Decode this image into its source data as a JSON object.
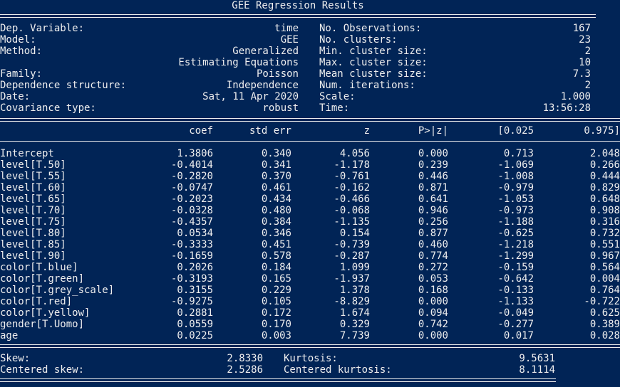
{
  "title": "GEE Regression Results",
  "info_rows": [
    [
      "Dep. Variable:",
      "time",
      "No. Observations:",
      "167"
    ],
    [
      "Model:",
      "GEE",
      "No. clusters:",
      "23"
    ],
    [
      "Method:",
      "Generalized",
      "Min. cluster size:",
      "2"
    ],
    [
      "",
      "Estimating Equations",
      "Max. cluster size:",
      "10"
    ],
    [
      "Family:",
      "Poisson",
      "Mean cluster size:",
      "7.3"
    ],
    [
      "Dependence structure:",
      "Independence",
      "Num. iterations:",
      "2"
    ],
    [
      "Date:",
      "Sat, 11 Apr 2020",
      "Scale:",
      "1.000"
    ],
    [
      "Covariance type:",
      "robust",
      "Time:",
      "13:56:28"
    ]
  ],
  "coef_headers": [
    "coef",
    "std err",
    "z",
    "P>|z|",
    "[0.025",
    "0.975]"
  ],
  "coef_rows": [
    [
      "Intercept",
      "1.3806",
      "0.340",
      "4.056",
      "0.000",
      "0.713",
      "2.048"
    ],
    [
      "level[T.50]",
      "-0.4014",
      "0.341",
      "-1.178",
      "0.239",
      "-1.069",
      "0.266"
    ],
    [
      "level[T.55]",
      "-0.2820",
      "0.370",
      "-0.761",
      "0.446",
      "-1.008",
      "0.444"
    ],
    [
      "level[T.60]",
      "-0.0747",
      "0.461",
      "-0.162",
      "0.871",
      "-0.979",
      "0.829"
    ],
    [
      "level[T.65]",
      "-0.2023",
      "0.434",
      "-0.466",
      "0.641",
      "-1.053",
      "0.648"
    ],
    [
      "level[T.70]",
      "-0.0328",
      "0.480",
      "-0.068",
      "0.946",
      "-0.973",
      "0.908"
    ],
    [
      "level[T.75]",
      "-0.4357",
      "0.384",
      "-1.135",
      "0.256",
      "-1.188",
      "0.316"
    ],
    [
      "level[T.80]",
      "0.0534",
      "0.346",
      "0.154",
      "0.877",
      "-0.625",
      "0.732"
    ],
    [
      "level[T.85]",
      "-0.3333",
      "0.451",
      "-0.739",
      "0.460",
      "-1.218",
      "0.551"
    ],
    [
      "level[T.90]",
      "-0.1659",
      "0.578",
      "-0.287",
      "0.774",
      "-1.299",
      "0.967"
    ],
    [
      "color[T.blue]",
      "0.2026",
      "0.184",
      "1.099",
      "0.272",
      "-0.159",
      "0.564"
    ],
    [
      "color[T.green]",
      "-0.3193",
      "0.165",
      "-1.937",
      "0.053",
      "-0.642",
      "0.004"
    ],
    [
      "color[T.grey_scale]",
      "0.3155",
      "0.229",
      "1.378",
      "0.168",
      "-0.133",
      "0.764"
    ],
    [
      "color[T.red]",
      "-0.9275",
      "0.105",
      "-8.829",
      "0.000",
      "-1.133",
      "-0.722"
    ],
    [
      "color[T.yellow]",
      "0.2881",
      "0.172",
      "1.674",
      "0.094",
      "-0.049",
      "0.625"
    ],
    [
      "gender[T.Uomo]",
      "0.0559",
      "0.170",
      "0.329",
      "0.742",
      "-0.277",
      "0.389"
    ],
    [
      "age",
      "0.0225",
      "0.003",
      "7.739",
      "0.000",
      "0.017",
      "0.028"
    ]
  ],
  "diag_rows": [
    [
      "Skew:",
      "2.8330",
      "Kurtosis:",
      "9.5631"
    ],
    [
      "Centered skew:",
      "2.5286",
      "Centered kurtosis:",
      "8.1114"
    ]
  ],
  "colors": {
    "background": "#012456",
    "foreground": "#eeeeee"
  }
}
